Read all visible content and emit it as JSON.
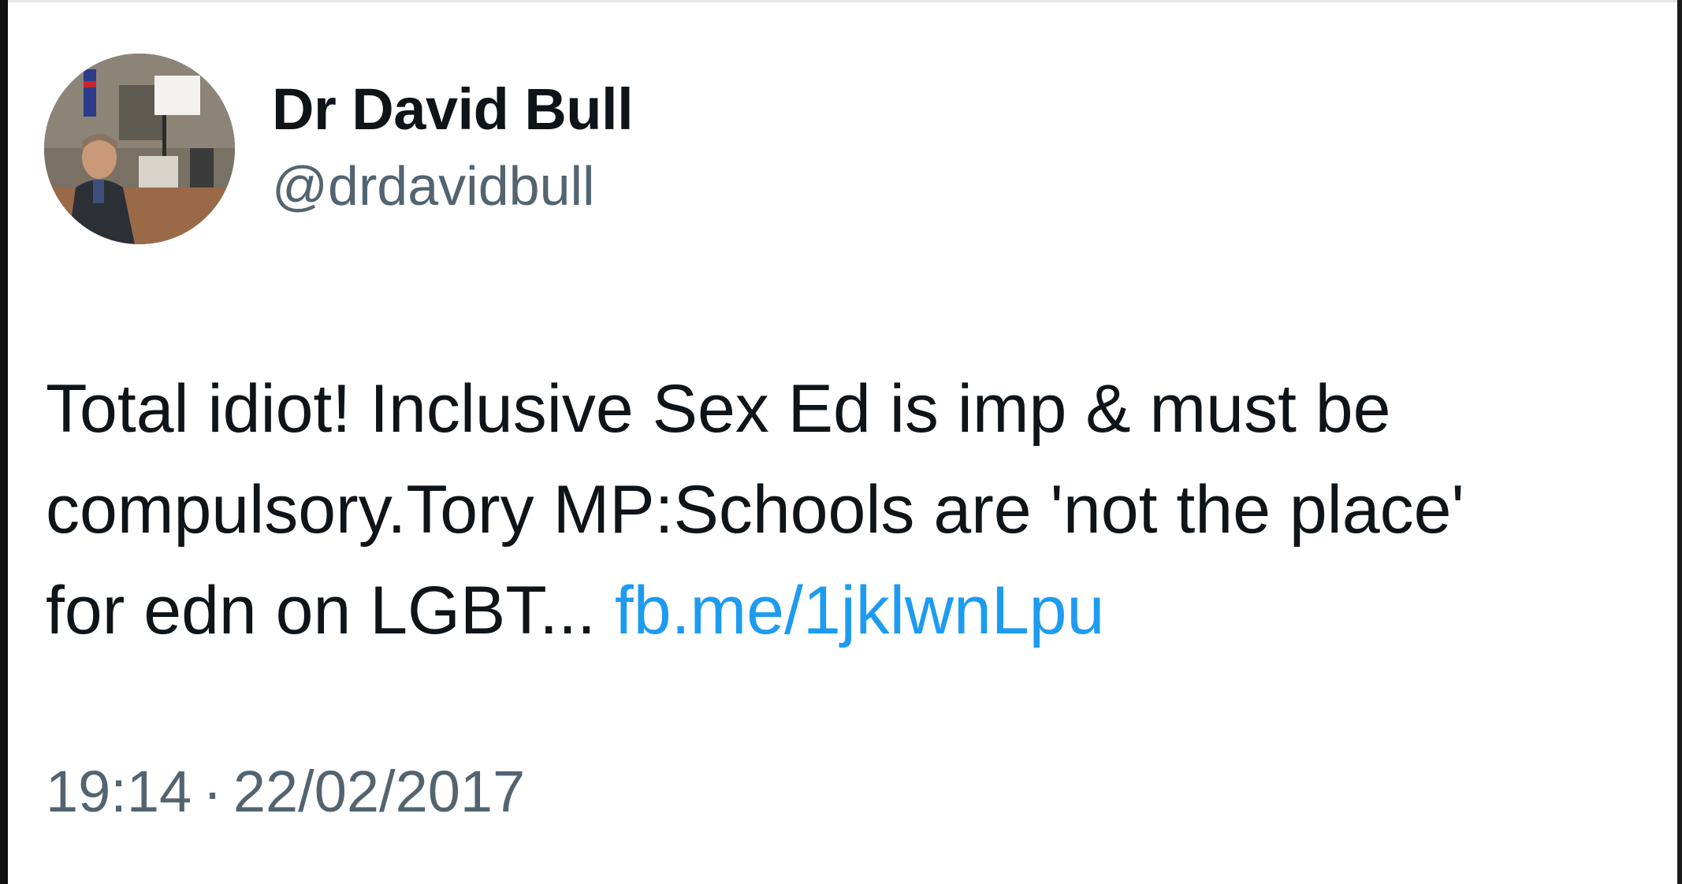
{
  "tweet": {
    "author": {
      "display_name": "Dr David Bull",
      "handle": "@drdavidbull",
      "avatar_icon": "profile-photo"
    },
    "text": {
      "line1": "Total idiot! Inclusive Sex Ed is imp & must be",
      "line2": "compulsory.Tory MP:Schools are 'not the place'",
      "line3_prefix": "for edn on LGBT... ",
      "link": "fb.me/1jklwnLpu"
    },
    "timestamp": {
      "time": "19:14",
      "separator": "·",
      "date": "22/02/2017"
    },
    "colors": {
      "text": "#0f1419",
      "secondary": "#536471",
      "link": "#1d9bf0"
    }
  }
}
